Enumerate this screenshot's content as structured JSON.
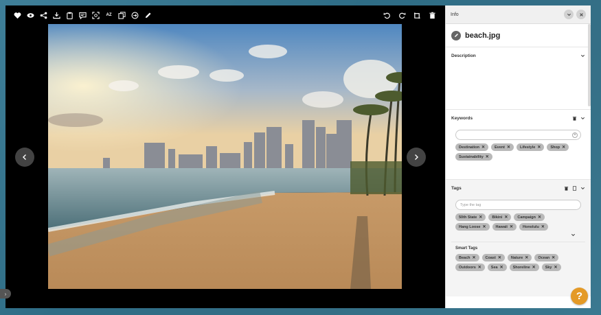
{
  "toolbar": {
    "left_icons": [
      "heart-icon",
      "eye-icon",
      "share-icon",
      "download-icon",
      "clipboard-icon",
      "comment-icon",
      "face-scan-icon",
      "az-icon",
      "copy-icon",
      "compare-icon",
      "edit-pen-icon"
    ],
    "az_label": "AZ",
    "right_icons": [
      "rotate-left-icon",
      "rotate-right-icon",
      "crop-icon",
      "trash-icon"
    ]
  },
  "panel": {
    "title": "Info",
    "file_name": "beach.jpg",
    "description": {
      "title": "Description"
    },
    "keywords": {
      "title": "Keywords",
      "chips": [
        "Destination",
        "Event",
        "Lifestyle",
        "Shop",
        "Sustainability"
      ]
    },
    "tags": {
      "title": "Tags",
      "placeholder": "Type the tag",
      "chips": [
        "50th State",
        "Bikini",
        "Campaign",
        "Hang Loose",
        "Hawaii",
        "Honolulu"
      ]
    },
    "smart_tags": {
      "title": "Smart Tags",
      "chips": [
        "Beach",
        "Coast",
        "Nature",
        "Ocean",
        "Outdoors",
        "Sea",
        "Shoreline",
        "Sky"
      ]
    }
  },
  "help": {
    "label": "?"
  },
  "colors": {
    "help": "#e49a27",
    "chip": "#b9b9b9",
    "viewer_bg": "#000000"
  }
}
